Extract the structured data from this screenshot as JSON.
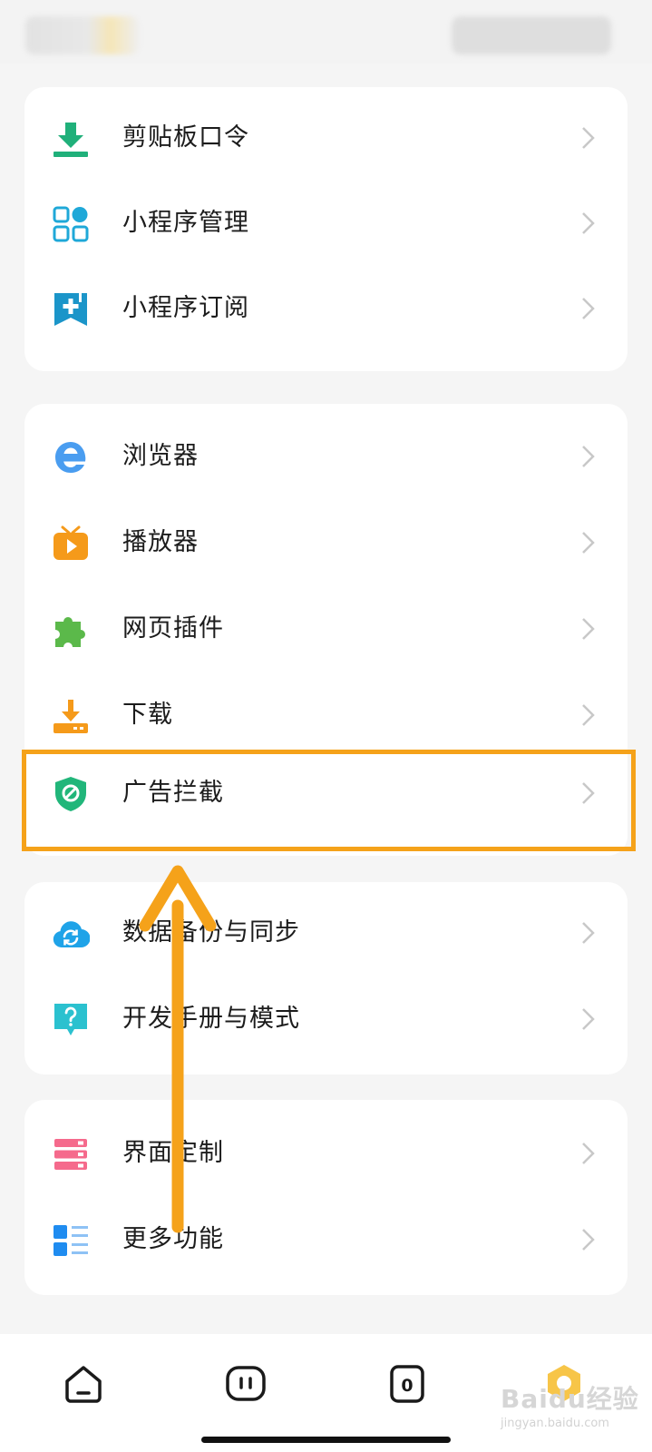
{
  "groups": [
    {
      "items": [
        {
          "label": "剪贴板口令",
          "icon": "clipboard-code-icon"
        },
        {
          "label": "小程序管理",
          "icon": "mini-program-manage-icon"
        },
        {
          "label": "小程序订阅",
          "icon": "mini-program-subscribe-icon"
        }
      ]
    },
    {
      "items": [
        {
          "label": "浏览器",
          "icon": "browser-icon"
        },
        {
          "label": "播放器",
          "icon": "player-icon"
        },
        {
          "label": "网页插件",
          "icon": "web-plugin-icon"
        },
        {
          "label": "下载",
          "icon": "download-icon"
        },
        {
          "label": "广告拦截",
          "icon": "ad-block-icon",
          "highlighted": true
        }
      ]
    },
    {
      "items": [
        {
          "label": "数据备份与同步",
          "icon": "backup-sync-icon"
        },
        {
          "label": "开发手册与模式",
          "icon": "dev-manual-icon"
        }
      ]
    },
    {
      "items": [
        {
          "label": "界面定制",
          "icon": "ui-customize-icon"
        },
        {
          "label": "更多功能",
          "icon": "more-features-icon"
        }
      ]
    }
  ],
  "bottom_nav": {
    "tabs": [
      {
        "icon": "home-icon"
      },
      {
        "icon": "chat-icon"
      },
      {
        "icon": "tabs-icon",
        "count": "0"
      },
      {
        "icon": "profile-icon"
      }
    ]
  },
  "watermark": {
    "text": "Baidu经验",
    "sub": "jingyan.baidu.com"
  },
  "colors": {
    "highlight": "#f5a21a",
    "background": "#f5f5f5",
    "card": "#ffffff"
  }
}
